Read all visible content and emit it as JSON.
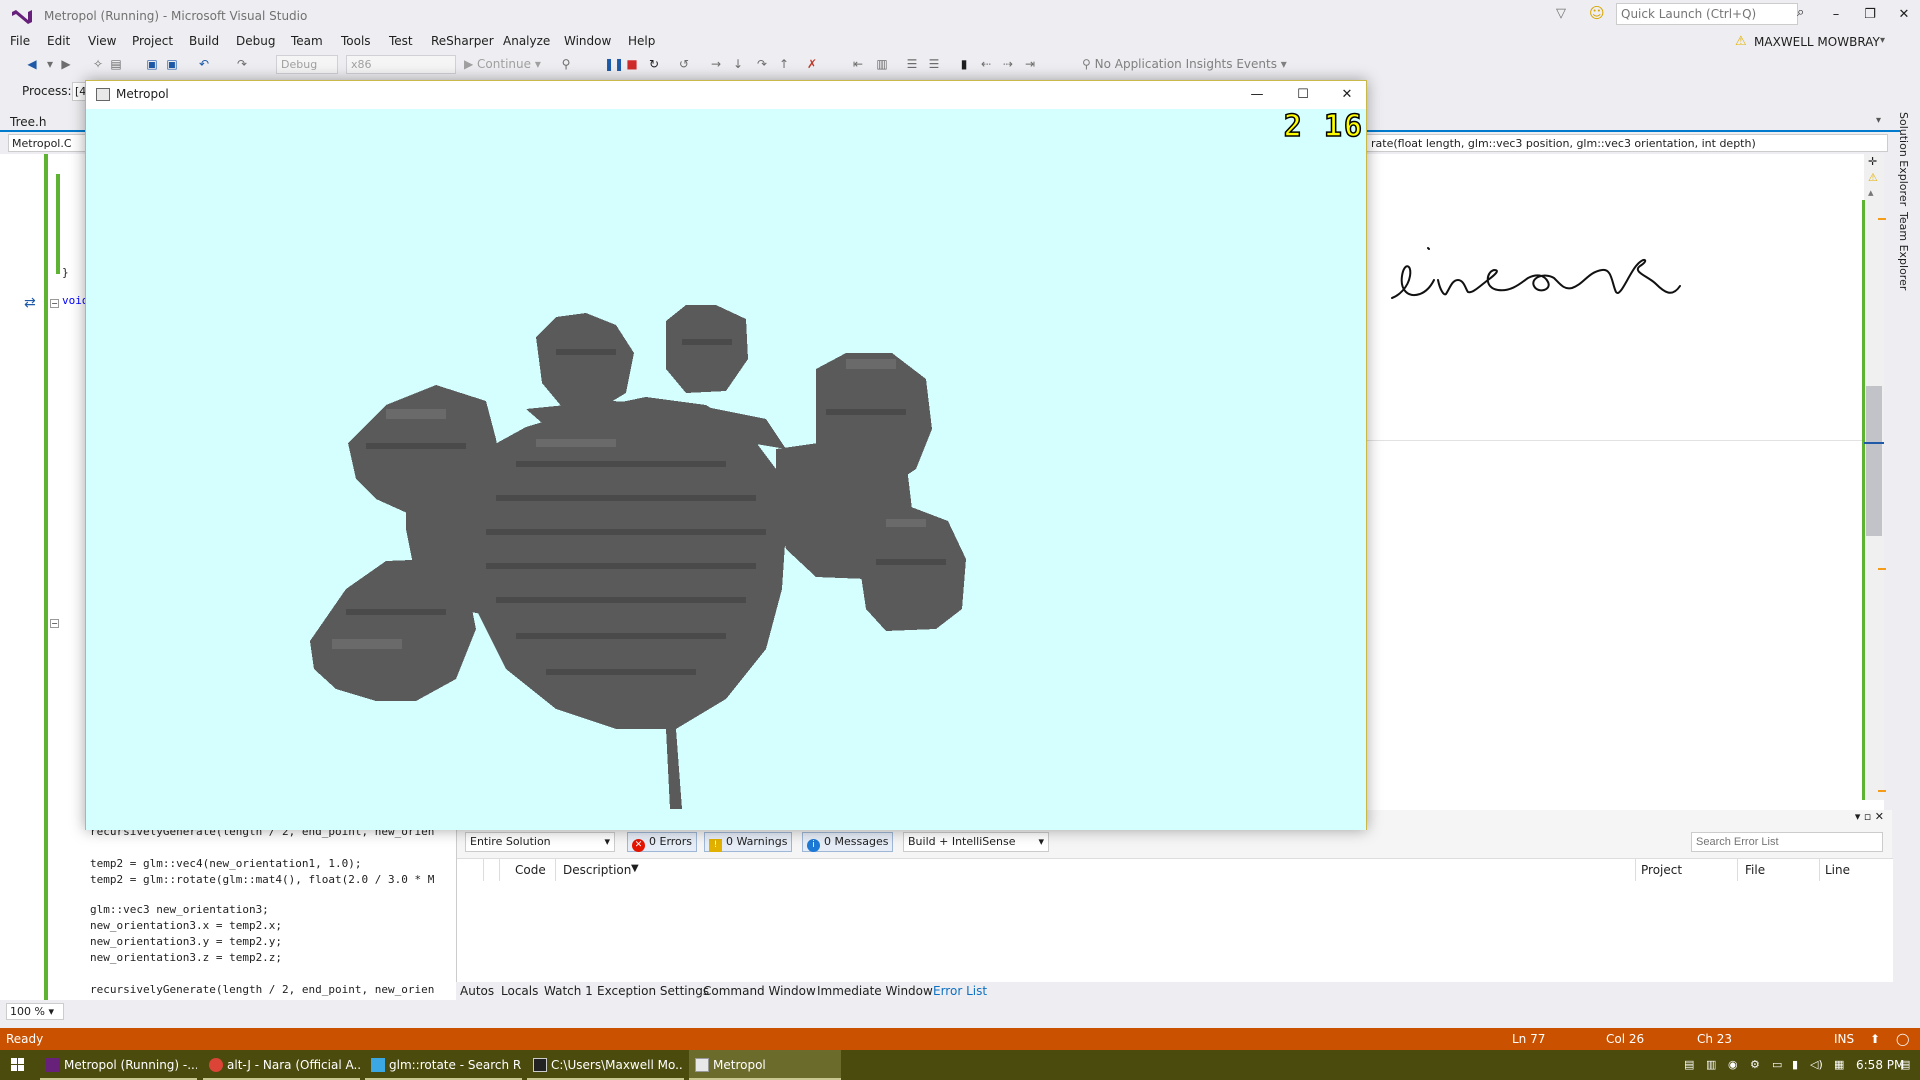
{
  "window": {
    "title": "Metropol (Running) - Microsoft Visual Studio"
  },
  "quick_launch": {
    "placeholder": "Quick Launch (Ctrl+Q)"
  },
  "user": {
    "name": "MAXWELL MOWBRAY"
  },
  "menu": [
    "File",
    "Edit",
    "View",
    "Project",
    "Build",
    "Debug",
    "Team",
    "Tools",
    "Test",
    "ReSharper",
    "Analyze",
    "Window",
    "Help"
  ],
  "toolbar": {
    "config": "Debug",
    "platform": "x86",
    "continue_label": "Continue",
    "insights_label": "No Application Insights Events"
  },
  "process": {
    "label": "Process:",
    "value": "[4"
  },
  "editor": {
    "tab_label": "Tree.h",
    "nav_left": "Metropol.C",
    "nav_right": "rate(float length, glm::vec3 position, glm::vec3 orientation, int depth)",
    "brace": "}",
    "void_kw": "void",
    "zoom": "100 %",
    "code": [
      "recursivelyGenerate(length / 2, end_point, new_orien",
      "",
      "temp2 = glm::vec4(new_orientation1, 1.0);",
      "temp2 = glm::rotate(glm::mat4(), float(2.0 / 3.0 * M",
      "",
      "glm::vec3 new_orientation3;",
      "new_orientation3.x = temp2.x;",
      "new_orientation3.y = temp2.y;",
      "new_orientation3.z = temp2.z;",
      "",
      "recursivelyGenerate(length / 2, end_point, new_orien"
    ]
  },
  "side_tabs": [
    "Solution Explorer",
    "Team Explorer"
  ],
  "metropol": {
    "title": "Metropol",
    "fps": "2 16",
    "sky_color": "#d4fffe",
    "tree_color": "#5a5a5a"
  },
  "error_list": {
    "scope": "Entire Solution",
    "errors": "0 Errors",
    "warnings": "0 Warnings",
    "messages": "0 Messages",
    "build_filter": "Build + IntelliSense",
    "search_placeholder": "Search Error List",
    "columns": [
      "Code",
      "Description",
      "Project",
      "File",
      "Line"
    ]
  },
  "bottom_tabs": [
    "Autos",
    "Locals",
    "Watch 1",
    "Exception Settings",
    "Command Window",
    "Immediate Window",
    "Error List"
  ],
  "status": {
    "state": "Ready",
    "ln": "Ln 77",
    "col": "Col 26",
    "ch": "Ch 23",
    "mode": "INS"
  },
  "taskbar": {
    "items": [
      "Metropol (Running) -...",
      "alt-J - Nara (Official A...",
      "glm::rotate - Search R...",
      "C:\\Users\\Maxwell Mo...",
      "Metropol"
    ],
    "time": "6:58 PM"
  }
}
